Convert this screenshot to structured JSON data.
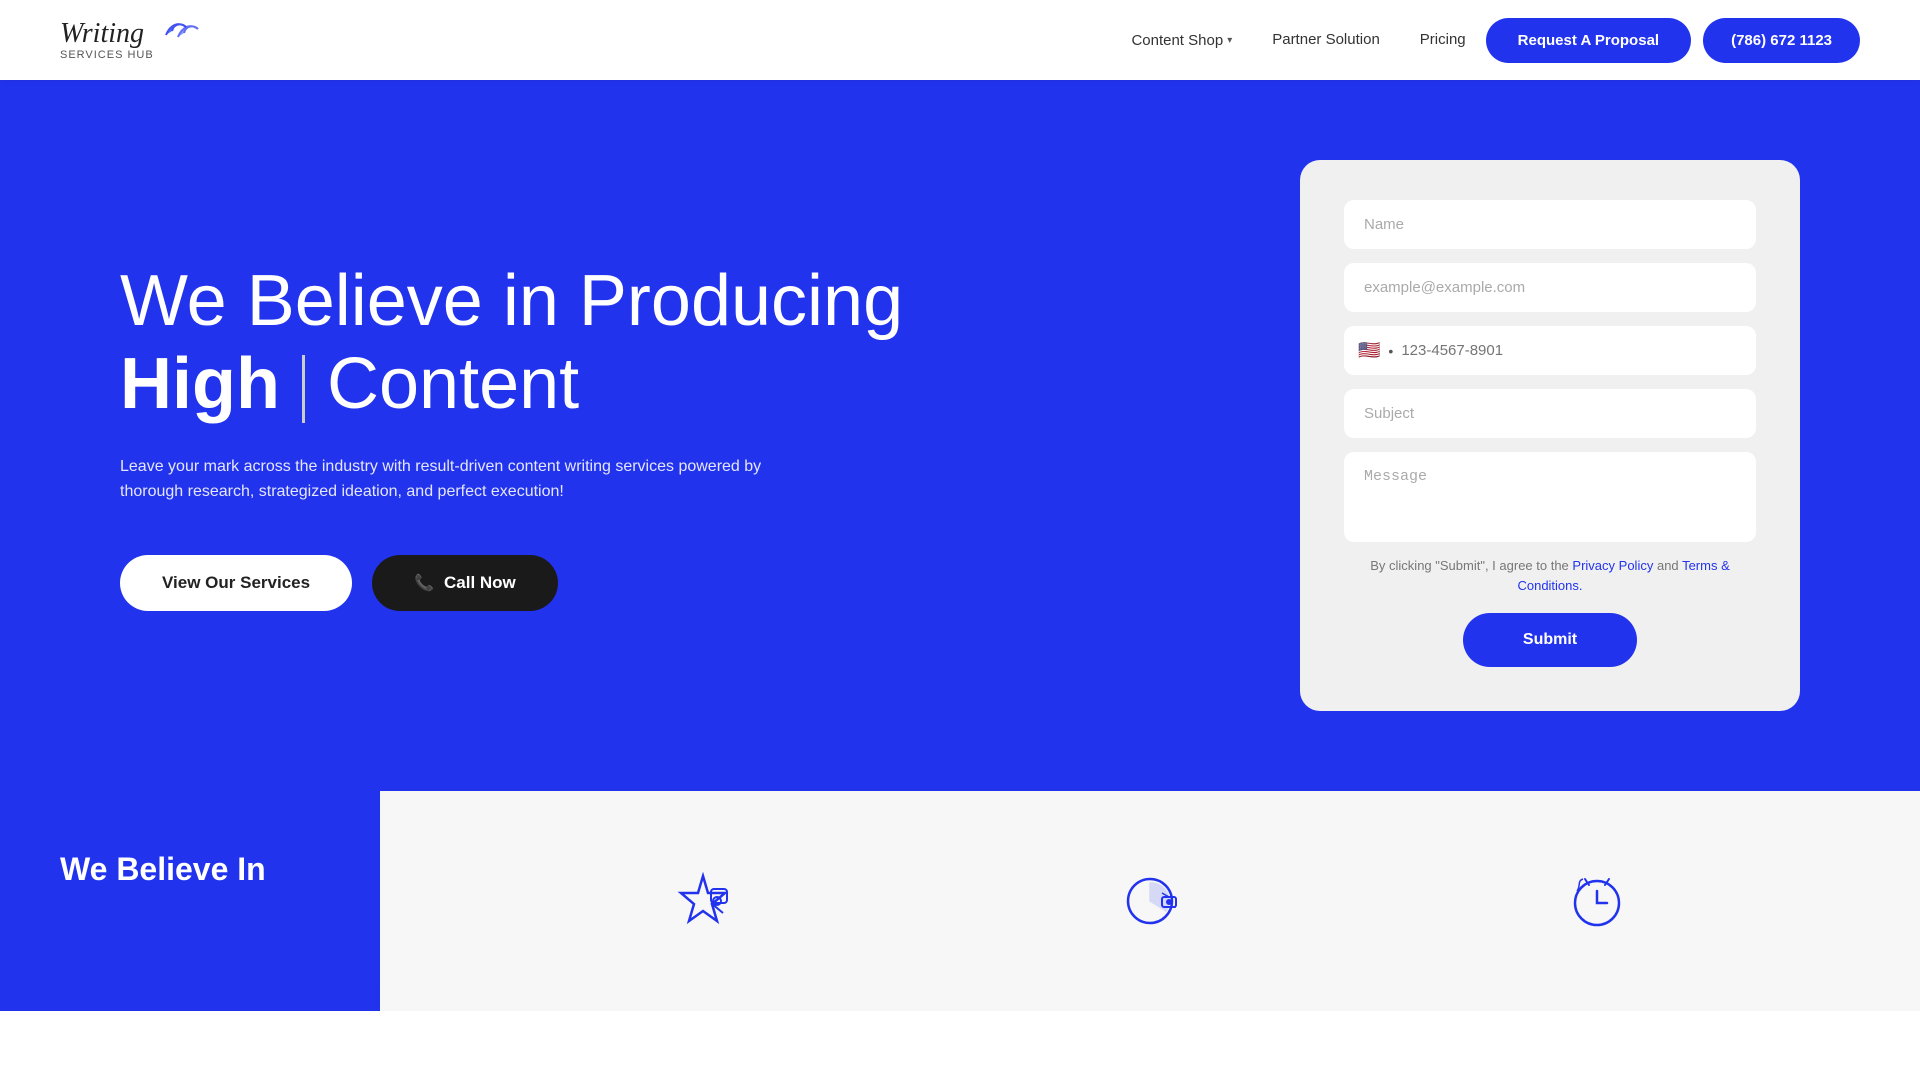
{
  "navbar": {
    "logo_script": "Writing",
    "logo_sub": "Services Hub",
    "content_shop_label": "Content Shop",
    "partner_solution_label": "Partner Solution",
    "pricing_label": "Pricing",
    "btn_proposal_label": "Request A Proposal",
    "btn_phone_label": "(786) 672 1123"
  },
  "hero": {
    "title_line1": "We Believe in Producing",
    "title_bold": "High",
    "title_rest": "Content",
    "subtitle": "Leave your mark across the industry with result-driven content writing services powered by thorough research, strategized ideation, and perfect execution!",
    "btn_services_label": "View Our Services",
    "btn_call_label": "Call Now"
  },
  "form": {
    "name_placeholder": "Name",
    "email_placeholder": "example@example.com",
    "phone_flag": "🇺🇸",
    "phone_code": "+",
    "phone_placeholder": "123-4567-8901",
    "subject_placeholder": "Subject",
    "message_placeholder": "Message",
    "legal_text": "By clicking \"Submit\", I agree to the",
    "privacy_label": "Privacy Policy",
    "and_text": "and",
    "terms_label": "Terms & Conditions.",
    "submit_label": "Submit"
  },
  "bottom": {
    "we_believe_label": "We Believe In"
  }
}
